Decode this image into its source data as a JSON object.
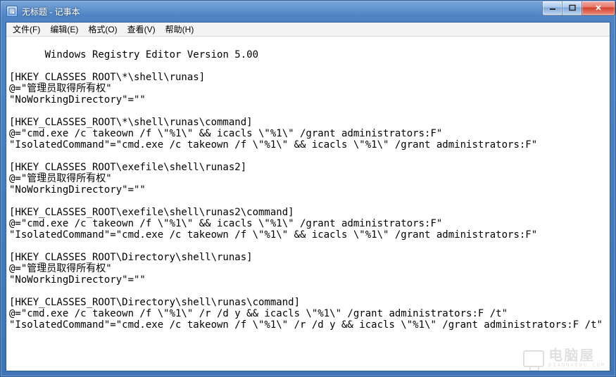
{
  "window": {
    "title": "无标题 - 记事本"
  },
  "menu": {
    "file": "文件(F)",
    "edit": "编辑(E)",
    "format": "格式(O)",
    "view": "查看(V)",
    "help": "帮助(H)"
  },
  "editor": {
    "content": "Windows Registry Editor Version 5.00\n\n[HKEY_CLASSES_ROOT\\*\\shell\\runas]\n@=\"管理员取得所有权\"\n\"NoWorkingDirectory\"=\"\"\n\n[HKEY_CLASSES_ROOT\\*\\shell\\runas\\command]\n@=\"cmd.exe /c takeown /f \\\"%1\\\" && icacls \\\"%1\\\" /grant administrators:F\"\n\"IsolatedCommand\"=\"cmd.exe /c takeown /f \\\"%1\\\" && icacls \\\"%1\\\" /grant administrators:F\"\n\n[HKEY_CLASSES_ROOT\\exefile\\shell\\runas2]\n@=\"管理员取得所有权\"\n\"NoWorkingDirectory\"=\"\"\n\n[HKEY_CLASSES_ROOT\\exefile\\shell\\runas2\\command]\n@=\"cmd.exe /c takeown /f \\\"%1\\\" && icacls \\\"%1\\\" /grant administrators:F\"\n\"IsolatedCommand\"=\"cmd.exe /c takeown /f \\\"%1\\\" && icacls \\\"%1\\\" /grant administrators:F\"\n\n[HKEY_CLASSES_ROOT\\Directory\\shell\\runas]\n@=\"管理员取得所有权\"\n\"NoWorkingDirectory\"=\"\"\n\n[HKEY_CLASSES_ROOT\\Directory\\shell\\runas\\command]\n@=\"cmd.exe /c takeown /f \\\"%1\\\" /r /d y && icacls \\\"%1\\\" /grant administrators:F /t\"\n\"IsolatedCommand\"=\"cmd.exe /c takeown /f \\\"%1\\\" /r /d y && icacls \\\"%1\\\" /grant administrators:F /t\""
  },
  "watermark": {
    "text_big": "电脑屋",
    "text_small": "DIANNAOWU.COM"
  }
}
